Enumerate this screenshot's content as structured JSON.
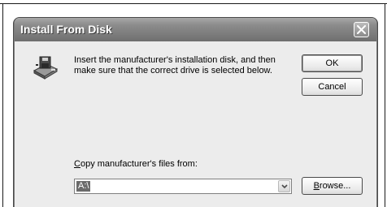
{
  "window": {
    "title": "Install From Disk",
    "close_icon": "close-icon"
  },
  "message": "Insert the manufacturer's installation disk, and then make sure that the correct drive is selected below.",
  "buttons": {
    "ok": "OK",
    "cancel": "Cancel",
    "browse_prefix": "",
    "browse_accel": "B",
    "browse_rest": "rowse..."
  },
  "copy_from": {
    "label_accel": "C",
    "label_rest": "opy manufacturer's files from:",
    "value": "A:\\"
  },
  "icons": {
    "setup": "disk-setup-icon",
    "dropdown": "chevron-down-icon"
  }
}
